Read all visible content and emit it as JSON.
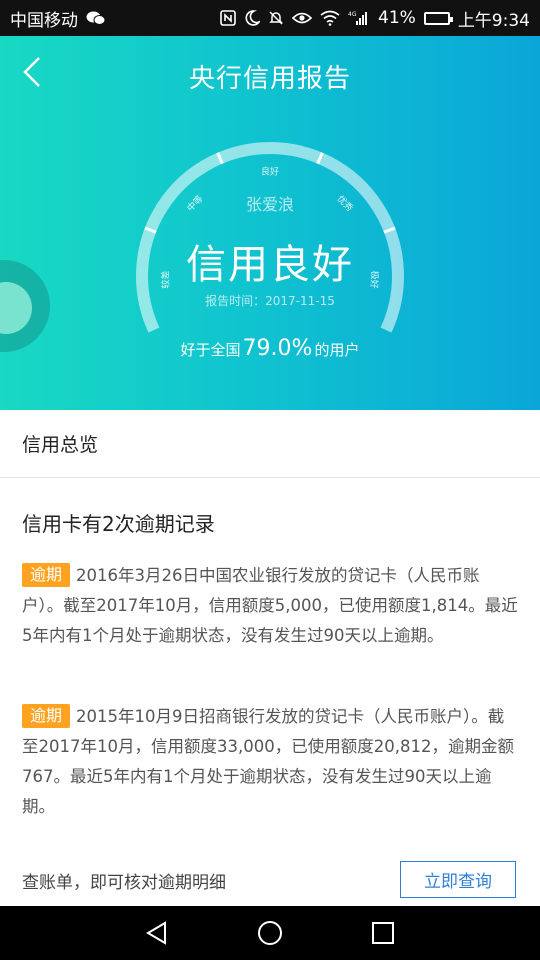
{
  "status_bar": {
    "carrier": "中国移动",
    "battery": "41%",
    "time": "上午9:34",
    "battery_level": 0.41,
    "icons": [
      "wechat-icon",
      "nfc-icon",
      "moon-icon",
      "mute-icon",
      "eye-icon",
      "wifi-icon",
      "signal-icon",
      "battery-icon"
    ]
  },
  "header": {
    "title": "央行信用报告",
    "back_icon": "chevron-left-icon"
  },
  "gauge": {
    "labels": [
      "较差",
      "中等",
      "良好",
      "优秀",
      "极好"
    ],
    "user_name": "张爱浪",
    "status": "信用良好",
    "report_time": "报告时间：2017-11-15",
    "percent_prefix": "好于全国",
    "percent_value": "79.0%",
    "percent_suffix": "的用户",
    "accent_color": "#ffffff",
    "bg_gradient": [
      "#18d9c3",
      "#0aa6d8"
    ]
  },
  "overview": {
    "title": "信用总览"
  },
  "records": {
    "title": "信用卡有2次逾期记录",
    "tag_color": "#ffa21f",
    "items": [
      {
        "tag": "逾期",
        "text": "2016年3月26日中国农业银行发放的贷记卡（人民币账户）。截至2017年10月，信用额度5,000，已使用额度1,814。最近5年内有1个月处于逾期状态，没有发生过90天以上逾期。"
      },
      {
        "tag": "逾期",
        "text": "2015年10月9日招商银行发放的贷记卡（人民币账户）。截至2017年10月，信用额度33,000，已使用额度20,812，逾期金额767。最近5年内有1个月处于逾期状态，没有发生过90天以上逾期。"
      }
    ]
  },
  "footer": {
    "hint": "查账单，即可核对逾期明细",
    "button": "立即查询",
    "button_color": "#2f7fd6"
  },
  "navbar": {
    "icons": [
      "back-triangle-icon",
      "home-circle-icon",
      "recents-square-icon"
    ]
  }
}
